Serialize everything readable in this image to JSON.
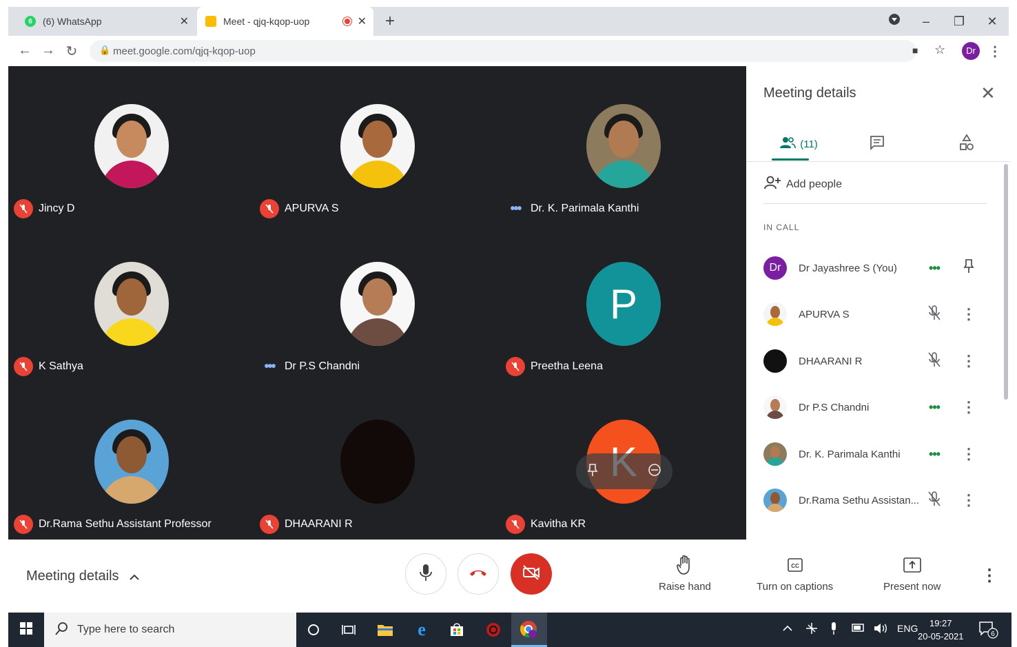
{
  "browser": {
    "tabs": [
      {
        "title": "(6) WhatsApp",
        "badge": "6"
      },
      {
        "title": "Meet - qjq-kqop-uop"
      }
    ],
    "url": "meet.google.com/qjq-kqop-uop",
    "profile_initials": "Dr"
  },
  "stage": {
    "participants": [
      {
        "name": "Jincy D",
        "status": "muted"
      },
      {
        "name": "APURVA S",
        "status": "muted"
      },
      {
        "name": "Dr. K. Parimala Kanthi",
        "status": "speaking"
      },
      {
        "name": "K Sathya",
        "status": "muted"
      },
      {
        "name": "Dr P.S Chandni",
        "status": "speaking"
      },
      {
        "name": "Preetha Leena",
        "status": "muted",
        "initial": "P",
        "avatar_color": "#12939a"
      },
      {
        "name": "Dr.Rama Sethu Assistant Professor",
        "status": "muted"
      },
      {
        "name": "DHAARANI R",
        "status": "muted"
      },
      {
        "name": "Kavitha KR",
        "status": "muted",
        "initial": "K",
        "avatar_color": "#f4511e"
      }
    ]
  },
  "panel": {
    "title": "Meeting details",
    "people_count": "(11)",
    "add_people": "Add people",
    "in_call_label": "IN CALL",
    "people": [
      {
        "name": "Dr Jayashree S (You)",
        "initials": "Dr",
        "status": "speaking",
        "action": "pin"
      },
      {
        "name": "APURVA S",
        "status": "muted",
        "action": "menu"
      },
      {
        "name": "DHAARANI R",
        "status": "muted",
        "action": "menu"
      },
      {
        "name": "Dr P.S Chandni",
        "status": "speaking",
        "action": "menu"
      },
      {
        "name": "Dr. K. Parimala Kanthi",
        "status": "speaking",
        "action": "menu"
      },
      {
        "name": "Dr.Rama Sethu Assistan...",
        "status": "muted",
        "action": "menu"
      }
    ]
  },
  "controls": {
    "meeting_details": "Meeting details",
    "raise_hand": "Raise hand",
    "captions": "Turn on captions",
    "present": "Present now"
  },
  "taskbar": {
    "search_placeholder": "Type here to search",
    "language": "ENG",
    "time": "19:27",
    "date": "20-05-2021",
    "notifications": "6"
  },
  "colors": {
    "meet_bg": "#202124",
    "mute_red": "#ea4335",
    "accent_teal": "#00796b",
    "end_call_red": "#d93025"
  }
}
